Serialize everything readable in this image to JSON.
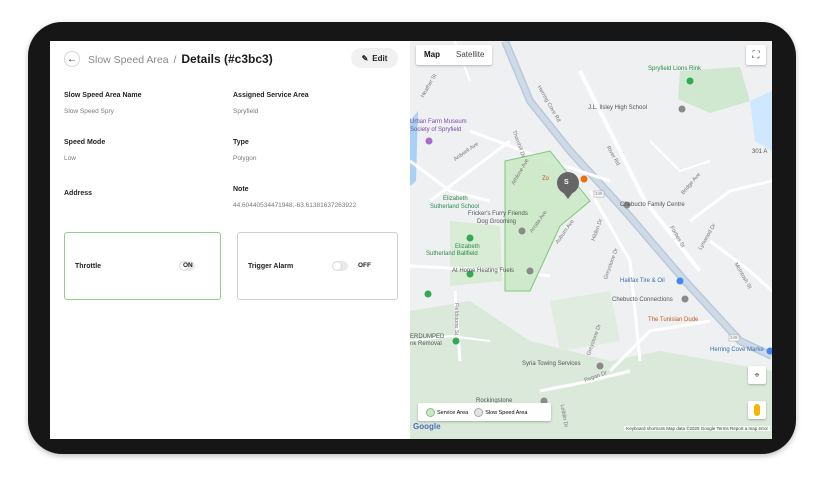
{
  "header": {
    "breadcrumb_parent": "Slow Speed Area",
    "breadcrumb_sep": "/",
    "title": "Details (#c3bc3)",
    "edit_label": "Edit"
  },
  "fields": {
    "name_label": "Slow Speed Area Name",
    "name_value": "Slow Speed Spry",
    "service_area_label": "Assigned Service Area",
    "service_area_value": "Spryfield",
    "speed_mode_label": "Speed Mode",
    "speed_mode_value": "Low",
    "type_label": "Type",
    "type_value": "Polygon",
    "address_label": "Address",
    "note_label": "Note",
    "note_value": "44.60440534471948,-63.61381637263922"
  },
  "cards": {
    "throttle_label": "Throttle",
    "throttle_state": "ON",
    "alarm_label": "Trigger Alarm",
    "alarm_state": "OFF"
  },
  "map": {
    "tab_map": "Map",
    "tab_satellite": "Satellite",
    "marker_label": "S",
    "labels": {
      "lions_rink": "Spryfield Lions Rink",
      "isley": "J.L. Ilsley High School",
      "urban_farm_1": "Urban Farm Museum",
      "urban_farm_2": "Society of Spryfield",
      "zo": "Zo",
      "elizabeth_sutherland_1": "Elizabeth",
      "elizabeth_sutherland_2": "Sutherland School",
      "furry_1": "Fricker's Furry Friends",
      "furry_2": "Dog Grooming",
      "chebucto_family": "Chebucto Family Centre",
      "ballfield_1": "Elizabeth",
      "ballfield_2": "Sutherland Ballfield",
      "heating": "At Home Heating Fuels",
      "halifax_tire": "Halifax Tire & Oil",
      "chebucto_conn": "Chebucto Connections",
      "tunisian": "The Tunisian Dude",
      "dumped_1": "ERDUMPED",
      "dumped_2": "nk Removal",
      "herring_market": "Herring Cove Marke",
      "syria": "Syria Towing Services",
      "rockingstone": "Rockingstone",
      "herring_rd": "Herring Cove Rd",
      "thornhill": "Thornhill Dr",
      "river_rd": "River Rd",
      "ardwell": "Ardwell Ave",
      "athlone": "Athlone Ave",
      "arrata": "Arrata Ave",
      "auburn": "Auburn Ave",
      "bridge": "Bridge Ave",
      "forbes": "Forbes St",
      "lynwood": "Lynwood Dr",
      "mcintosh": "McIntosh St",
      "greystone": "Greystone Dr",
      "fieldstone": "Fieldstone St",
      "regan": "Regan Dr",
      "leiblin": "Leiblin Dr",
      "hilden": "Hilden Dr",
      "heather": "Heather St",
      "num_301": "301 A",
      "route_349_a": "349",
      "route_349_b": "349"
    },
    "legend_service": "Service Area",
    "legend_slow": "Slow Speed Area",
    "google": "Google",
    "attribution": "Keyboard shortcuts   Map data ©2025 Google   Terms   Report a map error"
  },
  "colors": {
    "accent_green": "#8fd08f",
    "polygon_fill": "#c9e8c4",
    "polygon_stroke": "#7cc77a",
    "marker": "#666666"
  }
}
